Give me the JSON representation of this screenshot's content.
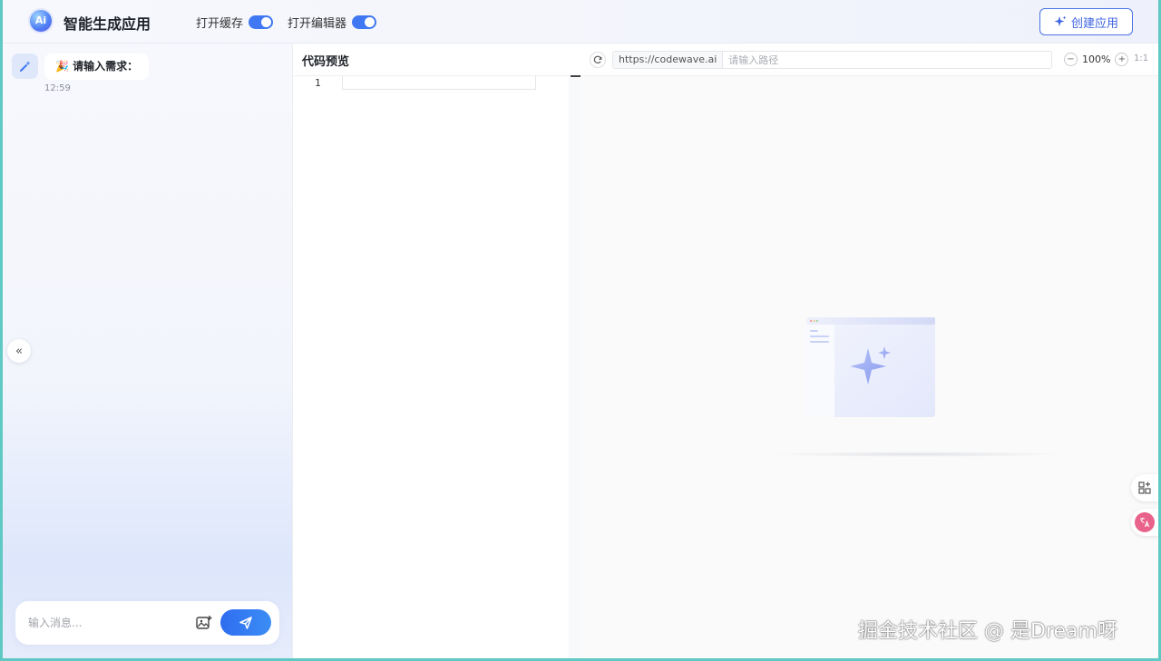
{
  "header": {
    "logo_text": "Ai",
    "app_title": "智能生成应用",
    "toggles": [
      {
        "label": "打开缓存",
        "state": "on"
      },
      {
        "label": "打开编辑器",
        "state": "on"
      }
    ],
    "create_button_label": "创建应用"
  },
  "chat": {
    "messages": [
      {
        "text": "🎉 请输入需求：",
        "time": "12:59"
      }
    ],
    "input_placeholder": "输入消息..."
  },
  "code_preview": {
    "title": "代码预览",
    "line_numbers": [
      "1"
    ]
  },
  "preview": {
    "url_base": "https://codewave.ai",
    "path_placeholder": "请输入路径",
    "zoom_level": "100%",
    "ratio_label": "1:1"
  },
  "watermark": "掘金技术社区 @ 是Dream呀",
  "colors": {
    "accent": "#3f78f2",
    "send_button": "#2f6df0",
    "frame_border": "#5fc9c4"
  }
}
